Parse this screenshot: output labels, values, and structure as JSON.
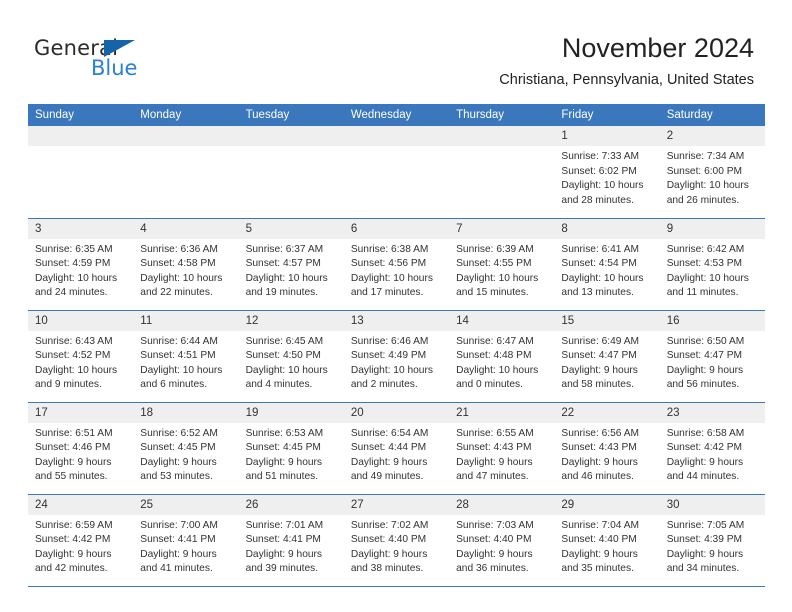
{
  "brand": {
    "name_part1": "General",
    "name_part2": "Blue",
    "color_dark": "#2b2b2b",
    "color_blue": "#2b7fd4",
    "triangle_color": "#1464aa"
  },
  "header": {
    "title": "November 2024",
    "location": "Christiana, Pennsylvania, United States"
  },
  "theme": {
    "header_bg": "#3a77bd",
    "header_text": "#ffffff",
    "daynum_bg": "#efefef",
    "cell_bg": "#ffffff",
    "row_divider": "#3a77bd",
    "body_text": "#333333"
  },
  "weekday_headers": [
    "Sunday",
    "Monday",
    "Tuesday",
    "Wednesday",
    "Thursday",
    "Friday",
    "Saturday"
  ],
  "weeks": [
    [
      {
        "day": "",
        "blank": true,
        "sunrise": "",
        "sunset": "",
        "daylight_line1": "",
        "daylight_line2": ""
      },
      {
        "day": "",
        "blank": true,
        "sunrise": "",
        "sunset": "",
        "daylight_line1": "",
        "daylight_line2": ""
      },
      {
        "day": "",
        "blank": true,
        "sunrise": "",
        "sunset": "",
        "daylight_line1": "",
        "daylight_line2": ""
      },
      {
        "day": "",
        "blank": true,
        "sunrise": "",
        "sunset": "",
        "daylight_line1": "",
        "daylight_line2": ""
      },
      {
        "day": "",
        "blank": true,
        "sunrise": "",
        "sunset": "",
        "daylight_line1": "",
        "daylight_line2": ""
      },
      {
        "day": "1",
        "blank": false,
        "sunrise": "Sunrise: 7:33 AM",
        "sunset": "Sunset: 6:02 PM",
        "daylight_line1": "Daylight: 10 hours",
        "daylight_line2": "and 28 minutes."
      },
      {
        "day": "2",
        "blank": false,
        "sunrise": "Sunrise: 7:34 AM",
        "sunset": "Sunset: 6:00 PM",
        "daylight_line1": "Daylight: 10 hours",
        "daylight_line2": "and 26 minutes."
      }
    ],
    [
      {
        "day": "3",
        "blank": false,
        "sunrise": "Sunrise: 6:35 AM",
        "sunset": "Sunset: 4:59 PM",
        "daylight_line1": "Daylight: 10 hours",
        "daylight_line2": "and 24 minutes."
      },
      {
        "day": "4",
        "blank": false,
        "sunrise": "Sunrise: 6:36 AM",
        "sunset": "Sunset: 4:58 PM",
        "daylight_line1": "Daylight: 10 hours",
        "daylight_line2": "and 22 minutes."
      },
      {
        "day": "5",
        "blank": false,
        "sunrise": "Sunrise: 6:37 AM",
        "sunset": "Sunset: 4:57 PM",
        "daylight_line1": "Daylight: 10 hours",
        "daylight_line2": "and 19 minutes."
      },
      {
        "day": "6",
        "blank": false,
        "sunrise": "Sunrise: 6:38 AM",
        "sunset": "Sunset: 4:56 PM",
        "daylight_line1": "Daylight: 10 hours",
        "daylight_line2": "and 17 minutes."
      },
      {
        "day": "7",
        "blank": false,
        "sunrise": "Sunrise: 6:39 AM",
        "sunset": "Sunset: 4:55 PM",
        "daylight_line1": "Daylight: 10 hours",
        "daylight_line2": "and 15 minutes."
      },
      {
        "day": "8",
        "blank": false,
        "sunrise": "Sunrise: 6:41 AM",
        "sunset": "Sunset: 4:54 PM",
        "daylight_line1": "Daylight: 10 hours",
        "daylight_line2": "and 13 minutes."
      },
      {
        "day": "9",
        "blank": false,
        "sunrise": "Sunrise: 6:42 AM",
        "sunset": "Sunset: 4:53 PM",
        "daylight_line1": "Daylight: 10 hours",
        "daylight_line2": "and 11 minutes."
      }
    ],
    [
      {
        "day": "10",
        "blank": false,
        "sunrise": "Sunrise: 6:43 AM",
        "sunset": "Sunset: 4:52 PM",
        "daylight_line1": "Daylight: 10 hours",
        "daylight_line2": "and 9 minutes."
      },
      {
        "day": "11",
        "blank": false,
        "sunrise": "Sunrise: 6:44 AM",
        "sunset": "Sunset: 4:51 PM",
        "daylight_line1": "Daylight: 10 hours",
        "daylight_line2": "and 6 minutes."
      },
      {
        "day": "12",
        "blank": false,
        "sunrise": "Sunrise: 6:45 AM",
        "sunset": "Sunset: 4:50 PM",
        "daylight_line1": "Daylight: 10 hours",
        "daylight_line2": "and 4 minutes."
      },
      {
        "day": "13",
        "blank": false,
        "sunrise": "Sunrise: 6:46 AM",
        "sunset": "Sunset: 4:49 PM",
        "daylight_line1": "Daylight: 10 hours",
        "daylight_line2": "and 2 minutes."
      },
      {
        "day": "14",
        "blank": false,
        "sunrise": "Sunrise: 6:47 AM",
        "sunset": "Sunset: 4:48 PM",
        "daylight_line1": "Daylight: 10 hours",
        "daylight_line2": "and 0 minutes."
      },
      {
        "day": "15",
        "blank": false,
        "sunrise": "Sunrise: 6:49 AM",
        "sunset": "Sunset: 4:47 PM",
        "daylight_line1": "Daylight: 9 hours",
        "daylight_line2": "and 58 minutes."
      },
      {
        "day": "16",
        "blank": false,
        "sunrise": "Sunrise: 6:50 AM",
        "sunset": "Sunset: 4:47 PM",
        "daylight_line1": "Daylight: 9 hours",
        "daylight_line2": "and 56 minutes."
      }
    ],
    [
      {
        "day": "17",
        "blank": false,
        "sunrise": "Sunrise: 6:51 AM",
        "sunset": "Sunset: 4:46 PM",
        "daylight_line1": "Daylight: 9 hours",
        "daylight_line2": "and 55 minutes."
      },
      {
        "day": "18",
        "blank": false,
        "sunrise": "Sunrise: 6:52 AM",
        "sunset": "Sunset: 4:45 PM",
        "daylight_line1": "Daylight: 9 hours",
        "daylight_line2": "and 53 minutes."
      },
      {
        "day": "19",
        "blank": false,
        "sunrise": "Sunrise: 6:53 AM",
        "sunset": "Sunset: 4:45 PM",
        "daylight_line1": "Daylight: 9 hours",
        "daylight_line2": "and 51 minutes."
      },
      {
        "day": "20",
        "blank": false,
        "sunrise": "Sunrise: 6:54 AM",
        "sunset": "Sunset: 4:44 PM",
        "daylight_line1": "Daylight: 9 hours",
        "daylight_line2": "and 49 minutes."
      },
      {
        "day": "21",
        "blank": false,
        "sunrise": "Sunrise: 6:55 AM",
        "sunset": "Sunset: 4:43 PM",
        "daylight_line1": "Daylight: 9 hours",
        "daylight_line2": "and 47 minutes."
      },
      {
        "day": "22",
        "blank": false,
        "sunrise": "Sunrise: 6:56 AM",
        "sunset": "Sunset: 4:43 PM",
        "daylight_line1": "Daylight: 9 hours",
        "daylight_line2": "and 46 minutes."
      },
      {
        "day": "23",
        "blank": false,
        "sunrise": "Sunrise: 6:58 AM",
        "sunset": "Sunset: 4:42 PM",
        "daylight_line1": "Daylight: 9 hours",
        "daylight_line2": "and 44 minutes."
      }
    ],
    [
      {
        "day": "24",
        "blank": false,
        "sunrise": "Sunrise: 6:59 AM",
        "sunset": "Sunset: 4:42 PM",
        "daylight_line1": "Daylight: 9 hours",
        "daylight_line2": "and 42 minutes."
      },
      {
        "day": "25",
        "blank": false,
        "sunrise": "Sunrise: 7:00 AM",
        "sunset": "Sunset: 4:41 PM",
        "daylight_line1": "Daylight: 9 hours",
        "daylight_line2": "and 41 minutes."
      },
      {
        "day": "26",
        "blank": false,
        "sunrise": "Sunrise: 7:01 AM",
        "sunset": "Sunset: 4:41 PM",
        "daylight_line1": "Daylight: 9 hours",
        "daylight_line2": "and 39 minutes."
      },
      {
        "day": "27",
        "blank": false,
        "sunrise": "Sunrise: 7:02 AM",
        "sunset": "Sunset: 4:40 PM",
        "daylight_line1": "Daylight: 9 hours",
        "daylight_line2": "and 38 minutes."
      },
      {
        "day": "28",
        "blank": false,
        "sunrise": "Sunrise: 7:03 AM",
        "sunset": "Sunset: 4:40 PM",
        "daylight_line1": "Daylight: 9 hours",
        "daylight_line2": "and 36 minutes."
      },
      {
        "day": "29",
        "blank": false,
        "sunrise": "Sunrise: 7:04 AM",
        "sunset": "Sunset: 4:40 PM",
        "daylight_line1": "Daylight: 9 hours",
        "daylight_line2": "and 35 minutes."
      },
      {
        "day": "30",
        "blank": false,
        "sunrise": "Sunrise: 7:05 AM",
        "sunset": "Sunset: 4:39 PM",
        "daylight_line1": "Daylight: 9 hours",
        "daylight_line2": "and 34 minutes."
      }
    ]
  ]
}
